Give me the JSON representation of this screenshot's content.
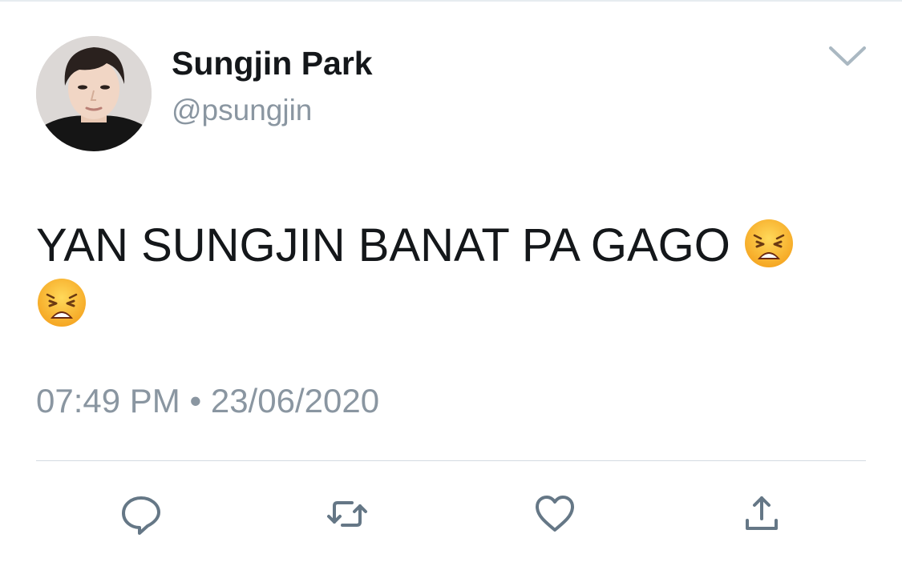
{
  "tweet": {
    "author": {
      "display_name": "Sungjin Park",
      "handle": "@psungjin"
    },
    "text": "YAN SUNGJIN BANAT PA GAGO",
    "emojis": [
      "weary-face-emoji",
      "weary-face-emoji"
    ],
    "time": "07:49 PM",
    "separator": "•",
    "date": "23/06/2020"
  },
  "actions": [
    "reply-icon",
    "retweet-icon",
    "like-icon",
    "share-icon"
  ],
  "colors": {
    "text": "#14171a",
    "muted": "#8a96a1",
    "icon": "#657786",
    "divider": "#d3dbe1"
  }
}
